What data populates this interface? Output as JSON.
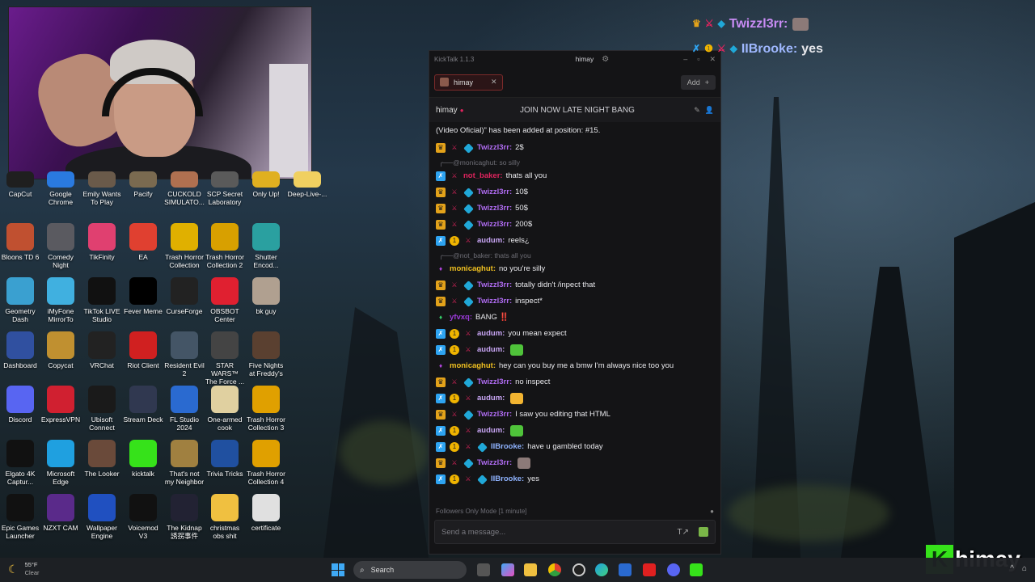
{
  "webcam": {},
  "desktop_icons": [
    {
      "label": "CapCut",
      "x": 0,
      "y": 0
    },
    {
      "label": "Google Chrome"
    },
    {
      "label": "Emily Wants To Play"
    },
    {
      "label": "Pacify"
    },
    {
      "label": "CUCKOLD SIMULATO..."
    },
    {
      "label": "SCP Secret Laboratory"
    },
    {
      "label": "Only Up!"
    },
    {
      "label": "Deep-Live-..."
    },
    {
      "label": "Bloons TD 6"
    },
    {
      "label": "Comedy Night"
    },
    {
      "label": "TikFinity"
    },
    {
      "label": "EA"
    },
    {
      "label": "Trash Horror Collection"
    },
    {
      "label": "Trash Horror Collection 2"
    },
    {
      "label": "Shutter Encod..."
    },
    {
      "label": "Geometry Dash"
    },
    {
      "label": "iMyFone MirrorTo"
    },
    {
      "label": "TikTok LIVE Studio"
    },
    {
      "label": "Fever Meme"
    },
    {
      "label": "CurseForge"
    },
    {
      "label": "OBSBOT Center"
    },
    {
      "label": "bk guy"
    },
    {
      "label": "Dashboard"
    },
    {
      "label": "Copycat"
    },
    {
      "label": "VRChat"
    },
    {
      "label": "Riot Client"
    },
    {
      "label": "Resident Evil 2"
    },
    {
      "label": "STAR WARS™ The Force ..."
    },
    {
      "label": "Five Nights at Freddy's"
    },
    {
      "label": "Discord"
    },
    {
      "label": "ExpressVPN"
    },
    {
      "label": "Ubisoft Connect"
    },
    {
      "label": "Stream Deck"
    },
    {
      "label": "FL Studio 2024"
    },
    {
      "label": "One-armed cook"
    },
    {
      "label": "Trash Horror Collection 3"
    },
    {
      "label": "Elgato 4K Captur..."
    },
    {
      "label": "Microsoft Edge"
    },
    {
      "label": "The Looker"
    },
    {
      "label": "kicktalk"
    },
    {
      "label": "That's not my Neighbor"
    },
    {
      "label": "Trivia Tricks"
    },
    {
      "label": "Trash Horror Collection 4"
    },
    {
      "label": "Epic Games Launcher"
    },
    {
      "label": "NZXT CAM"
    },
    {
      "label": "Wallpaper Engine"
    },
    {
      "label": "Voicemod V3"
    },
    {
      "label": "The Kidnap 誘拐事件"
    },
    {
      "label": "christmas obs shit"
    },
    {
      "label": "certificate"
    }
  ],
  "kicktalk": {
    "app_title": "KickTalk 1.1.3",
    "user_tab": "himay",
    "channel_tab": "himay",
    "add_label": "Add",
    "channel_name": "himay",
    "stream_title": "JOIN NOW LATE NIGHT BANG",
    "messages": [
      {
        "kind": "system",
        "text": "(Video Oficial)\" has been added at position: #15."
      },
      {
        "kind": "msg",
        "badges": [
          "crown",
          "sword",
          "cube"
        ],
        "user": "Twizzl3rr:",
        "color": "#b06cf2",
        "text": "2$"
      },
      {
        "kind": "reply",
        "text": "@monicaghut: so silly"
      },
      {
        "kind": "msg",
        "badges": [
          "sub",
          "sword"
        ],
        "user": "not_baker:",
        "color": "#e0245e",
        "text": "thats all you"
      },
      {
        "kind": "msg",
        "badges": [
          "crown",
          "sword",
          "cube"
        ],
        "user": "Twizzl3rr:",
        "color": "#b06cf2",
        "text": "10$"
      },
      {
        "kind": "msg",
        "badges": [
          "crown",
          "sword",
          "cube"
        ],
        "user": "Twizzl3rr:",
        "color": "#b06cf2",
        "text": "50$"
      },
      {
        "kind": "msg",
        "badges": [
          "crown",
          "sword",
          "cube"
        ],
        "user": "Twizzl3rr:",
        "color": "#b06cf2",
        "text": "200$"
      },
      {
        "kind": "msg",
        "badges": [
          "sub",
          "gift",
          "sword"
        ],
        "user": "audum:",
        "color": "#c9a6f5",
        "text": "reels¿"
      },
      {
        "kind": "reply",
        "text": "@not_baker: thats all you"
      },
      {
        "kind": "msg",
        "badges": [
          "vip"
        ],
        "user": "monicaghut:",
        "color": "#f0c020",
        "text": "no you're silly"
      },
      {
        "kind": "msg",
        "badges": [
          "crown",
          "sword",
          "cube"
        ],
        "user": "Twizzl3rr:",
        "color": "#b06cf2",
        "text": "totally didn't /inpect that"
      },
      {
        "kind": "msg",
        "badges": [
          "crown",
          "sword",
          "cube"
        ],
        "user": "Twizzl3rr:",
        "color": "#b06cf2",
        "text": "inspect*"
      },
      {
        "kind": "msg",
        "badges": [
          "og"
        ],
        "user": "yfvxq:",
        "color": "#9a3ad8",
        "text": "BANG ‼️"
      },
      {
        "kind": "msg",
        "badges": [
          "sub",
          "gift",
          "sword"
        ],
        "user": "audum:",
        "color": "#c9a6f5",
        "text": "you mean expect"
      },
      {
        "kind": "msg",
        "badges": [
          "sub",
          "gift",
          "sword"
        ],
        "user": "audum:",
        "color": "#c9a6f5",
        "text": "",
        "emote": "#4fc33a"
      },
      {
        "kind": "msg",
        "badges": [
          "vip"
        ],
        "user": "monicaghut:",
        "color": "#f0c020",
        "text": "hey can you buy me a bmw I'm always nice too you"
      },
      {
        "kind": "msg",
        "badges": [
          "crown",
          "sword",
          "cube"
        ],
        "user": "Twizzl3rr:",
        "color": "#b06cf2",
        "text": "no inspect"
      },
      {
        "kind": "msg",
        "badges": [
          "sub",
          "gift",
          "sword"
        ],
        "user": "audum:",
        "color": "#c9a6f5",
        "text": "",
        "emote": "#f2b431"
      },
      {
        "kind": "msg",
        "badges": [
          "crown",
          "sword",
          "cube"
        ],
        "user": "Twizzl3rr:",
        "color": "#b06cf2",
        "text": "I saw you editing that HTML"
      },
      {
        "kind": "msg",
        "badges": [
          "sub",
          "gift",
          "sword"
        ],
        "user": "audum:",
        "color": "#c9a6f5",
        "text": "",
        "emote": "#4fc33a"
      },
      {
        "kind": "msg",
        "badges": [
          "sub",
          "gift",
          "sword",
          "cube"
        ],
        "user": "IIBrooke:",
        "color": "#8fb3ff",
        "text": "have u gambled today"
      },
      {
        "kind": "msg",
        "badges": [
          "crown",
          "sword",
          "cube"
        ],
        "user": "Twizzl3rr:",
        "color": "#b06cf2",
        "text": "",
        "emote": "#8c7a78"
      },
      {
        "kind": "msg",
        "badges": [
          "sub",
          "gift",
          "sword",
          "cube"
        ],
        "user": "IIBrooke:",
        "color": "#8fb3ff",
        "text": "yes"
      }
    ],
    "followers_notice": "Followers Only Mode [1 minute]",
    "input_placeholder": "Send a message..."
  },
  "overlay": [
    {
      "user": "Twizzl3rr:",
      "color": "#c98cf5",
      "text": ""
    },
    {
      "user": "IIBrooke:",
      "color": "#9fb8ff",
      "text": "yes"
    }
  ],
  "logo_text": "himay",
  "taskbar": {
    "temperature": "55°F",
    "condition": "Clear",
    "search_label": "Search"
  }
}
